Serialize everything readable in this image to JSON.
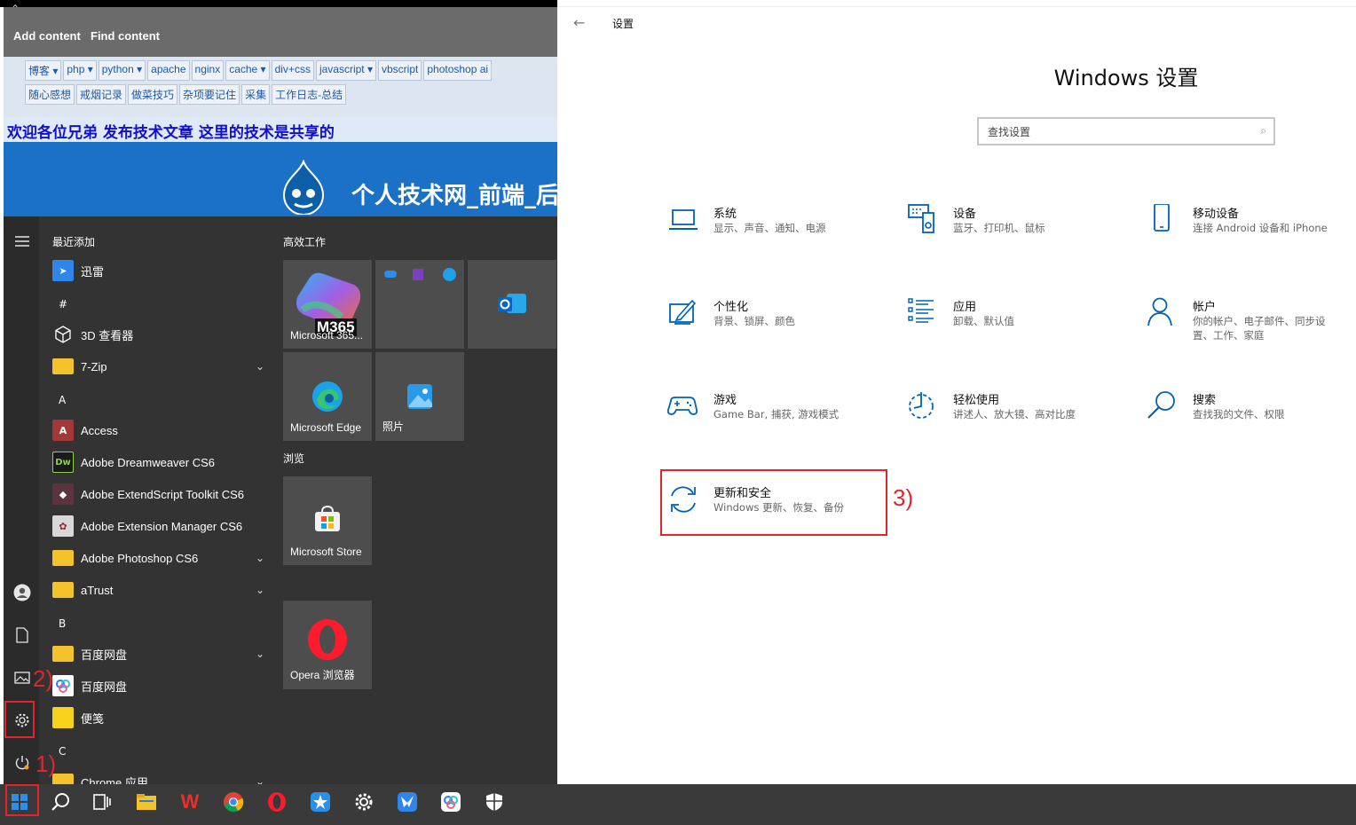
{
  "website": {
    "admin_links": [
      "Add content",
      "Find content"
    ],
    "nav_row1": [
      "博客 ▾",
      "php ▾",
      "python ▾",
      "apache",
      "nginx",
      "cache ▾",
      "div+css",
      "javascript ▾",
      "vbscript",
      "photoshop ai"
    ],
    "nav_row2": [
      "随心感想",
      "戒烟记录",
      "做菜技巧",
      "杂项要记住",
      "采集",
      "工作日志-总结"
    ],
    "welcome": "欢迎各位兄弟 发布技术文章 这里的技术是共享的",
    "banner_title": "个人技术网_前端_后"
  },
  "start_menu": {
    "recent_header": "最近添加",
    "apps": {
      "xunlei": "迅雷",
      "hash": "#",
      "viewer3d": "3D 查看器",
      "zip7": "7-Zip",
      "a": "A",
      "access": "Access",
      "dreamweaver": "Adobe Dreamweaver CS6",
      "extendscript": "Adobe ExtendScript Toolkit CS6",
      "extension_manager": "Adobe Extension Manager CS6",
      "photoshop": "Adobe Photoshop CS6",
      "atrust": "aTrust",
      "b": "B",
      "baidu_folder": "百度网盘",
      "baidu_app": "百度网盘",
      "sticky": "便笺",
      "c": "C",
      "chrome_apps": "Chrome 应用"
    },
    "group_productivity": "高效工作",
    "group_browse": "浏览",
    "tiles": {
      "m365": "Microsoft 365...",
      "m365_badge": "M365",
      "edge": "Microsoft Edge",
      "photos": "照片",
      "store": "Microsoft Store",
      "opera": "Opera 浏览器"
    }
  },
  "settings": {
    "window_title": "设置",
    "heading": "Windows 设置",
    "search_placeholder": "查找设置",
    "items": [
      {
        "name": "系统",
        "desc": "显示、声音、通知、电源",
        "icon": "laptop-icon"
      },
      {
        "name": "设备",
        "desc": "蓝牙、打印机、鼠标",
        "icon": "devices-icon"
      },
      {
        "name": "移动设备",
        "desc": "连接 Android 设备和 iPhone",
        "icon": "phone-icon"
      },
      {
        "name": "个性化",
        "desc": "背景、锁屏、颜色",
        "icon": "personalization-icon"
      },
      {
        "name": "应用",
        "desc": "卸载、默认值",
        "icon": "apps-list-icon"
      },
      {
        "name": "帐户",
        "desc": "你的帐户、电子邮件、同步设置、工作、家庭",
        "icon": "account-icon"
      },
      {
        "name": "游戏",
        "desc": "Game Bar, 捕获, 游戏模式",
        "icon": "gamepad-icon"
      },
      {
        "name": "轻松使用",
        "desc": "讲述人、放大镜、高对比度",
        "icon": "ease-of-access-icon"
      },
      {
        "name": "搜索",
        "desc": "查找我的文件、权限",
        "icon": "search-icon"
      },
      {
        "name": "更新和安全",
        "desc": "Windows 更新、恢复、备份",
        "icon": "update-icon"
      }
    ]
  },
  "annotations": {
    "step1": "1)",
    "step2": "2)",
    "step3": "3)"
  },
  "colors": {
    "accent": "#0063b1",
    "annotation_red": "#e0262d",
    "start_bg": "#333333",
    "taskbar_bg": "#3a3a3a"
  }
}
